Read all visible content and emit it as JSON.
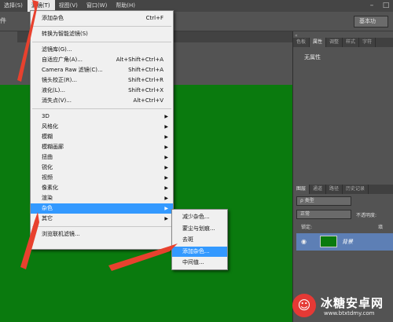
{
  "menubar": {
    "items": [
      "选择(S)",
      "滤镜(T)",
      "视图(V)",
      "窗口(W)",
      "帮助(H)"
    ],
    "active_index": 1
  },
  "optbar": {
    "left_label": "件",
    "workspace_label": "基本功"
  },
  "filter_menu": {
    "groups": [
      [
        {
          "label": "添加杂色",
          "shortcut": "Ctrl+F"
        }
      ],
      [
        {
          "label": "转换为智能滤镜(S)",
          "shortcut": ""
        }
      ],
      [
        {
          "label": "滤镜库(G)...",
          "shortcut": ""
        },
        {
          "label": "自适应广角(A)...",
          "shortcut": "Alt+Shift+Ctrl+A"
        },
        {
          "label": "Camera Raw 滤镜(C)...",
          "shortcut": "Shift+Ctrl+A"
        },
        {
          "label": "镜头校正(R)...",
          "shortcut": "Shift+Ctrl+R"
        },
        {
          "label": "液化(L)...",
          "shortcut": "Shift+Ctrl+X"
        },
        {
          "label": "消失点(V)...",
          "shortcut": "Alt+Ctrl+V"
        }
      ],
      [
        {
          "label": "3D",
          "submenu": true
        },
        {
          "label": "风格化",
          "submenu": true
        },
        {
          "label": "模糊",
          "submenu": true
        },
        {
          "label": "模糊画廊",
          "submenu": true
        },
        {
          "label": "扭曲",
          "submenu": true
        },
        {
          "label": "锐化",
          "submenu": true
        },
        {
          "label": "视频",
          "submenu": true
        },
        {
          "label": "像素化",
          "submenu": true
        },
        {
          "label": "渲染",
          "submenu": true
        },
        {
          "label": "杂色",
          "submenu": true,
          "highlighted": true
        },
        {
          "label": "其它",
          "submenu": true
        }
      ],
      [
        {
          "label": "浏览联机滤镜...",
          "shortcut": ""
        }
      ]
    ]
  },
  "noise_submenu": {
    "items": [
      "减少杂色...",
      "蒙尘与划痕...",
      "去斑",
      "添加杂色...",
      "中间值..."
    ],
    "highlighted_index": 3
  },
  "panels": {
    "top_tabs": [
      "色板",
      "属性",
      "调整",
      "样式",
      "字符"
    ],
    "top_selected": 1,
    "no_properties": "无属性",
    "layer_tabs": [
      "图层",
      "通道",
      "路径",
      "历史记录"
    ],
    "layer_selected": 0,
    "kind_filter": "ρ 类型",
    "blend_mode": "正常",
    "opacity_label": "不透明度:",
    "lock_label": "锁定:",
    "fill_label": "填",
    "layer_name": "背景"
  },
  "colors": {
    "canvas_green": "#0a7a0e",
    "highlight_blue": "#3399ff",
    "arrow_red": "#e8412e",
    "layer_selected": "#5d7fb5"
  },
  "watermark": {
    "title": "冰糖安卓网",
    "url": "www.btxtdmy.com"
  }
}
